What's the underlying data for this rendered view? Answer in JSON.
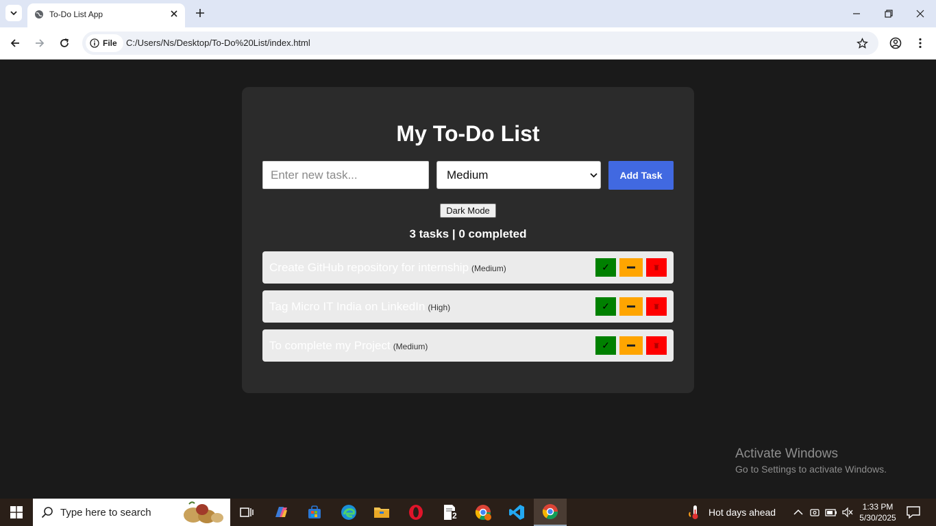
{
  "browser": {
    "tab_title": "To-Do List App",
    "chip_label": "File",
    "url": "C:/Users/Ns/Desktop/To-Do%20List/index.html"
  },
  "app": {
    "title": "My To-Do List",
    "input_placeholder": "Enter new task...",
    "priority_selected": "Medium",
    "add_button": "Add Task",
    "dark_mode_button": "Dark Mode",
    "stats": "3 tasks | 0 completed",
    "tasks": [
      {
        "text": "Create GitHub repository for internship",
        "priority": "(Medium)"
      },
      {
        "text": "Tag Micro IT India on LinkedIn",
        "priority": "(High)"
      },
      {
        "text": "To complete my Project",
        "priority": "(Medium)"
      }
    ],
    "done_symbol": "✓"
  },
  "watermark": {
    "title": "Activate Windows",
    "subtitle": "Go to Settings to activate Windows."
  },
  "taskbar": {
    "search_placeholder": "Type here to search",
    "weather": "Hot days ahead",
    "time": "1:33 PM",
    "date": "5/30/2025",
    "notepad_badge": "2"
  },
  "colors": {
    "accent": "#4169e1",
    "done": "#008000",
    "edit": "#ffa500",
    "delete": "#ff0000",
    "page_bg": "#1a1a1a",
    "card_bg": "#2b2b2b"
  }
}
